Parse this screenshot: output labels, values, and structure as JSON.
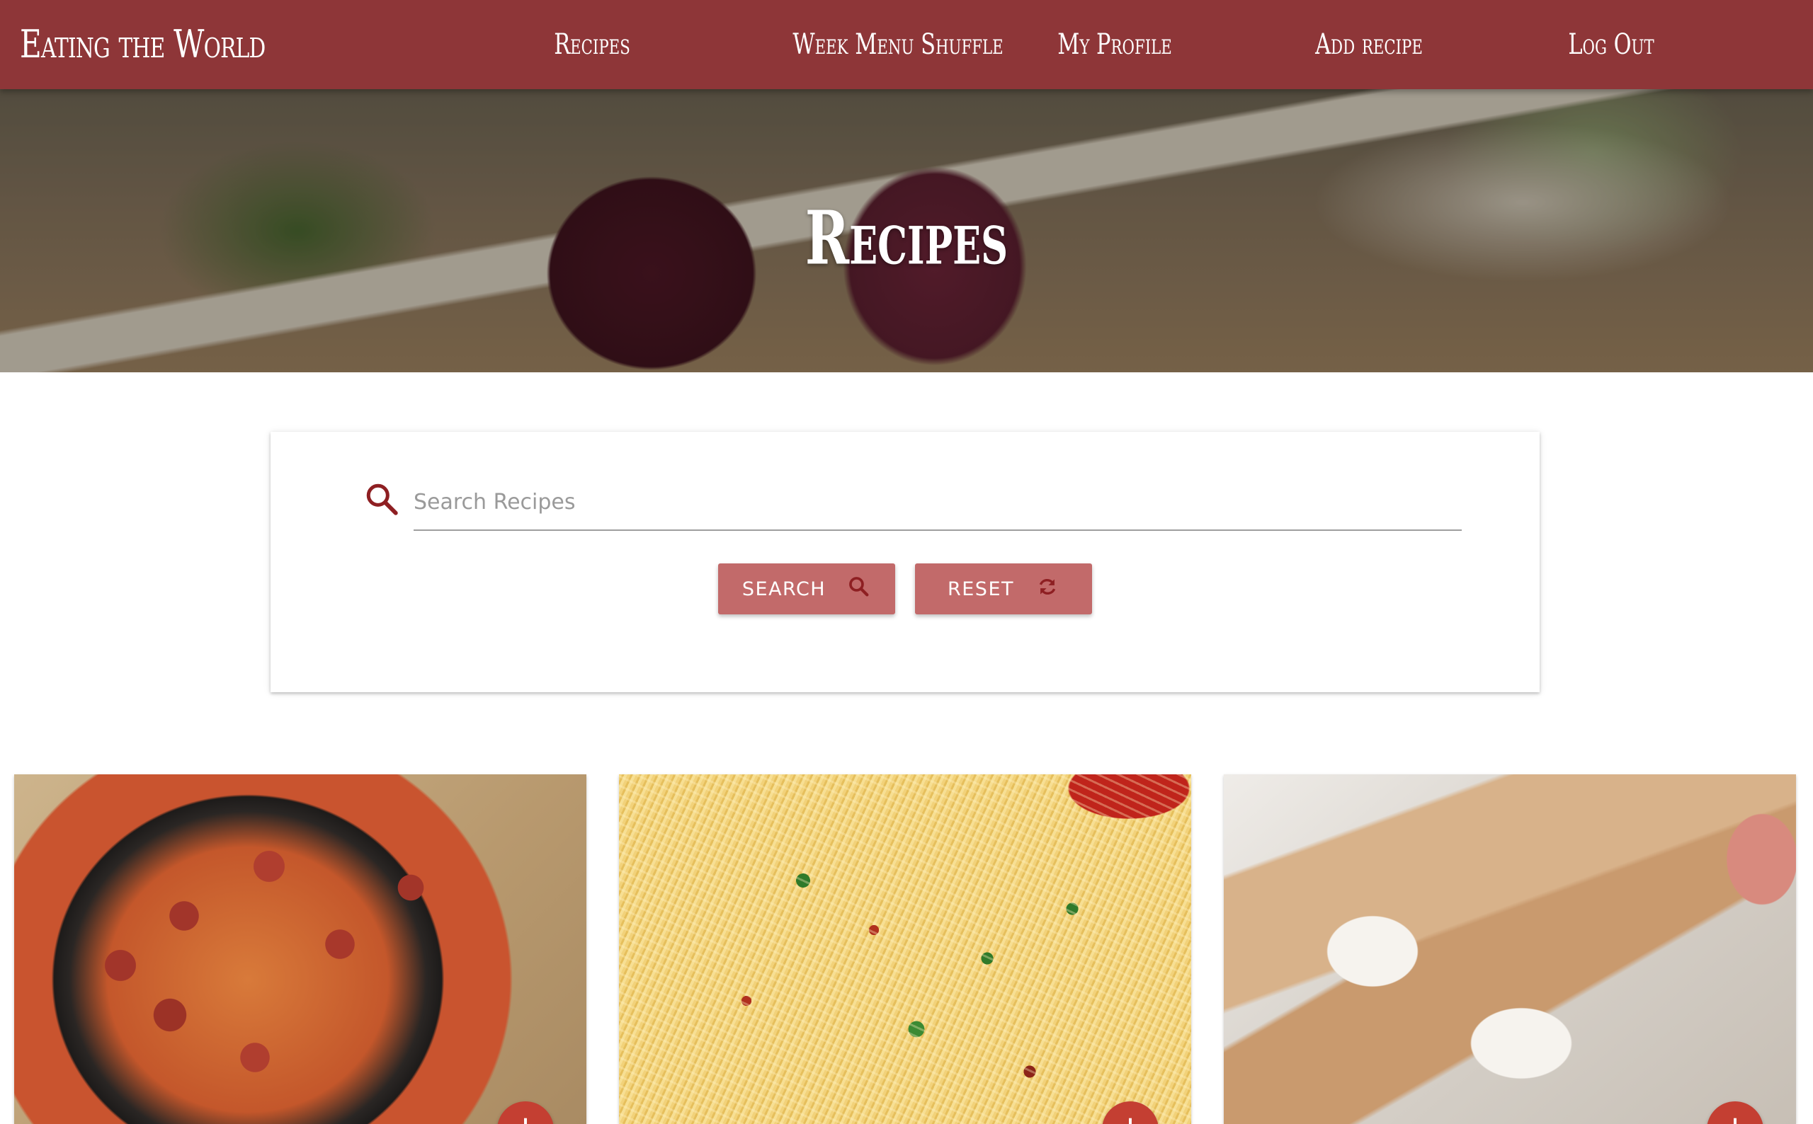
{
  "nav": {
    "brand": "Eating the World",
    "links": [
      "Recipes",
      "Week Menu Shuffle",
      "My Profile",
      "Add recipe",
      "Log Out"
    ]
  },
  "hero": {
    "title": "Recipes"
  },
  "search": {
    "placeholder": "Search Recipes",
    "value": "",
    "search_label": "SEARCH",
    "reset_label": "RESET"
  },
  "colors": {
    "navbar": "#8e3638",
    "button": "#c26a6a",
    "accent_icon": "#8e1f22",
    "fab": "#c43f32"
  },
  "icons": {
    "search_field": "search-icon",
    "search_button": "search-icon",
    "reset_button": "refresh-icon",
    "card_action": "add-icon"
  },
  "recipe_cards": [
    {
      "image": "sausage-and-vegetable-stew-photo",
      "action": "+"
    },
    {
      "image": "spaghetti-aglio-olio-photo",
      "action": "+"
    },
    {
      "image": "rolled-crepes-with-cream-photo",
      "action": "+"
    }
  ]
}
